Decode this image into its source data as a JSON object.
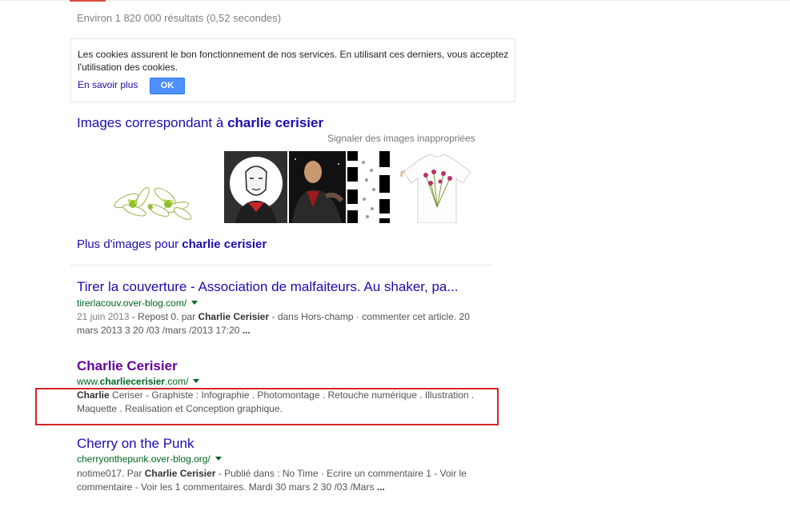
{
  "stats": "Environ 1 820 000 résultats (0,52 secondes)",
  "cookie_notice": {
    "text": "Les cookies assurent le bon fonctionnement de nos services. En utilisant ces derniers, vous acceptez l'utilisation des cookies.",
    "learn_more": "En savoir plus",
    "ok_button": "OK"
  },
  "images_section": {
    "heading_prefix": "Images correspondant à ",
    "heading_query": "charlie cerisier",
    "report_link": "Signaler des images inappropriées",
    "more_prefix": "Plus d'images pour ",
    "more_query": "charlie cerisier"
  },
  "results": [
    {
      "title": "Tirer la couverture - Association de malfaiteurs. Au shaker, pa...",
      "url": "tirerlacouv.over-blog.com/",
      "snippet_date": "21 juin 2013",
      "snippet_1": " - Repost 0. par ",
      "snippet_bold_1": "Charlie Cerisier",
      "snippet_2": " - dans Hors-champ · commenter cet article. 20 mars 2013 3 20 /03 /mars /2013 17:20 ",
      "snippet_end": "..."
    },
    {
      "title": "Charlie Cerisier",
      "url_prefix": "www.",
      "url_bold": "charliecerisier",
      "url_suffix": ".com/",
      "snippet_bold_1": "Charlie",
      "snippet_1": " Ceriser - Graphiste : Infographie . Photomontage . Retouche numérique . Illustration . Maquette . Realisation et Conception graphique."
    },
    {
      "title": "Cherry on the Punk",
      "url": "cherryonthepunk.over-blog.org/",
      "snippet_1": "notime017. Par ",
      "snippet_bold_1": "Charlie Cerisier",
      "snippet_2": " - Publié dans : No Time · Ecrire un commentaire 1 - Voir le commentaire - Voir les 1 commentaires. Mardi 30 mars 2 30 /03 /Mars ",
      "snippet_end": "..."
    }
  ],
  "colors": {
    "link": "#1a0dab",
    "visited": "#660099",
    "url": "#006621",
    "highlight": "#d42525",
    "ok_button": "#4d90fe"
  }
}
